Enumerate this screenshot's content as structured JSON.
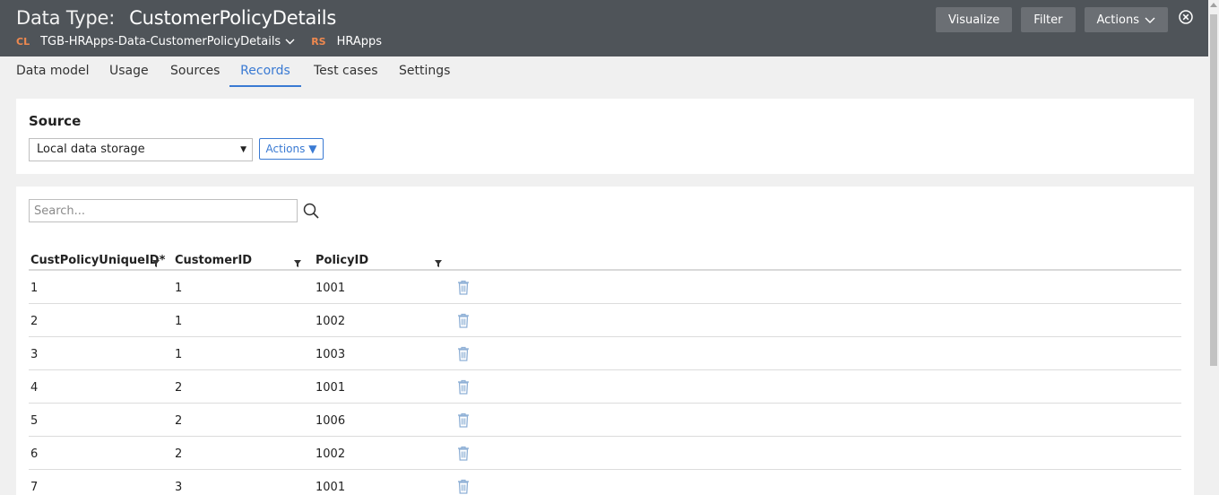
{
  "header": {
    "title_label": "Data Type:",
    "title_name": "CustomerPolicyDetails",
    "class_tag": "CL",
    "class_value": "TGB-HRApps-Data-CustomerPolicyDetails",
    "ruleset_tag": "RS",
    "ruleset_value": "HRApps",
    "buttons": {
      "visualize": "Visualize",
      "filter": "Filter",
      "actions": "Actions"
    }
  },
  "tabs": [
    "Data model",
    "Usage",
    "Sources",
    "Records",
    "Test cases",
    "Settings"
  ],
  "active_tab": "Records",
  "source": {
    "title": "Source",
    "selected": "Local data storage",
    "actions_label": "Actions ▼"
  },
  "records": {
    "search_placeholder": "Search...",
    "columns": [
      "CustPolicyUniqueID*",
      "CustomerID",
      "PolicyID"
    ],
    "rows": [
      [
        "1",
        "1",
        "1001"
      ],
      [
        "2",
        "1",
        "1002"
      ],
      [
        "3",
        "1",
        "1003"
      ],
      [
        "4",
        "2",
        "1001"
      ],
      [
        "5",
        "2",
        "1006"
      ],
      [
        "6",
        "2",
        "1002"
      ],
      [
        "7",
        "3",
        "1001"
      ]
    ]
  },
  "colors": {
    "header_bg": "#4f5459",
    "tag_orange": "#f0894f",
    "accent_blue": "#3a7ad3"
  }
}
